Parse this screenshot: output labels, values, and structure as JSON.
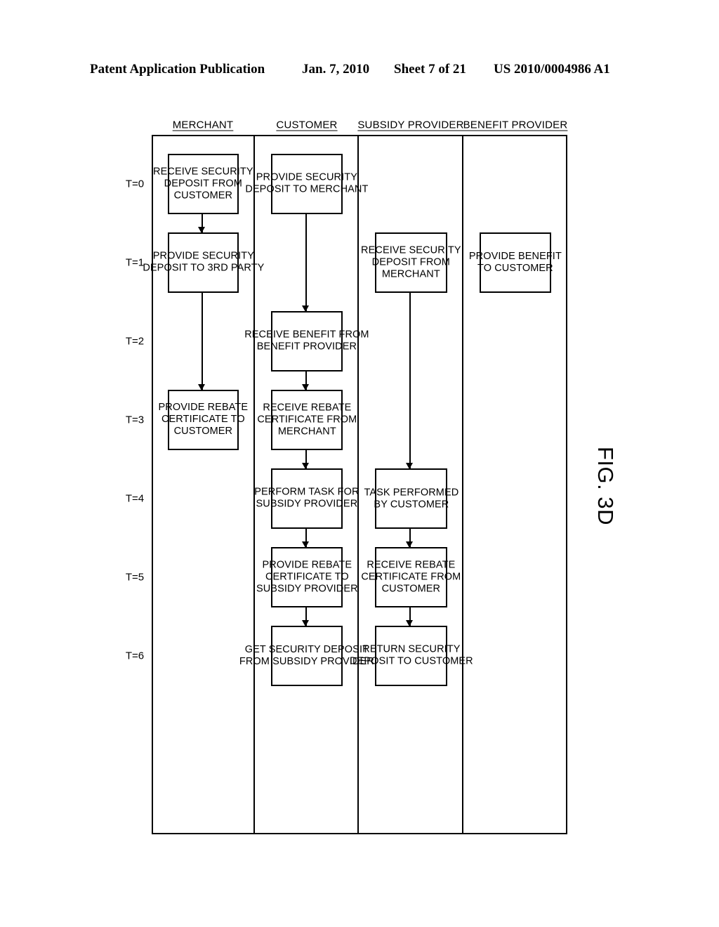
{
  "header": {
    "publication": "Patent Application Publication",
    "date": "Jan. 7, 2010",
    "sheet": "Sheet 7 of 21",
    "patent_number": "US 2010/0004986 A1"
  },
  "figure": {
    "caption": "FIG. 3D",
    "time_axis_label_prefix": "T=",
    "time_labels": [
      "T=0",
      "T=1",
      "T=2",
      "T=3",
      "T=4",
      "T=5",
      "T=6"
    ],
    "lanes": [
      {
        "id": "merchant",
        "title": "MERCHANT",
        "steps": [
          {
            "t": 0,
            "label": "RECEIVE SECURITY\nDEPOSIT FROM\nCUSTOMER"
          },
          {
            "t": 1,
            "label": "PROVIDE SECURITY\nDEPOSIT TO 3RD PARTY"
          },
          {
            "t": 3,
            "label": "PROVIDE REBATE\nCERTIFICATE TO\nCUSTOMER"
          }
        ],
        "arrows": [
          {
            "from_t": 0,
            "to_t": 1
          },
          {
            "from_t": 1,
            "to_t": 3
          }
        ]
      },
      {
        "id": "customer",
        "title": "CUSTOMER",
        "steps": [
          {
            "t": 0,
            "label": "PROVIDE SECURITY\nDEPOSIT TO MERCHANT"
          },
          {
            "t": 2,
            "label": "RECEIVE BENEFIT FROM\nBENEFIT PROVIDER"
          },
          {
            "t": 3,
            "label": "RECEIVE REBATE\nCERTIFICATE FROM\nMERCHANT"
          },
          {
            "t": 4,
            "label": "PERFORM TASK FOR\nSUBSIDY PROVIDER"
          },
          {
            "t": 5,
            "label": "PROVIDE REBATE\nCERTIFICATE TO\nSUBSIDY PROVIDER"
          },
          {
            "t": 6,
            "label": "GET SECURITY DEPOSIT\nFROM SUBSIDY PROVIDER"
          }
        ],
        "arrows": [
          {
            "from_t": 0,
            "to_t": 2
          },
          {
            "from_t": 2,
            "to_t": 3
          },
          {
            "from_t": 3,
            "to_t": 4
          },
          {
            "from_t": 4,
            "to_t": 5
          },
          {
            "from_t": 5,
            "to_t": 6
          }
        ]
      },
      {
        "id": "subsidy-provider",
        "title": "SUBSIDY PROVIDER",
        "steps": [
          {
            "t": 1,
            "label": "RECEIVE SECURITY\nDEPOSIT FROM\nMERCHANT"
          },
          {
            "t": 4,
            "label": "TASK PERFORMED\nBY CUSTOMER"
          },
          {
            "t": 5,
            "label": "RECEIVE REBATE\nCERTIFICATE FROM\nCUSTOMER"
          },
          {
            "t": 6,
            "label": "RETURN SECURITY\nDEPOSIT TO CUSTOMER"
          }
        ],
        "arrows": [
          {
            "from_t": 1,
            "to_t": 4
          },
          {
            "from_t": 4,
            "to_t": 5
          },
          {
            "from_t": 5,
            "to_t": 6
          }
        ]
      },
      {
        "id": "benefit-provider",
        "title": "BENEFIT PROVIDER",
        "steps": [
          {
            "t": 1,
            "label": "PROVIDE BENEFIT\nTO CUSTOMER"
          }
        ],
        "arrows": []
      }
    ]
  },
  "chart_data": {
    "type": "diagram",
    "diagram_type": "swimlane-flowchart",
    "orientation": "rotated-90-ccw",
    "title": "FIG. 3D",
    "axis": "time",
    "axis_ticks": [
      "T=0",
      "T=1",
      "T=2",
      "T=3",
      "T=4",
      "T=5",
      "T=6"
    ],
    "lane_order_top_to_bottom": [
      "BENEFIT PROVIDER",
      "SUBSIDY PROVIDER",
      "CUSTOMER",
      "MERCHANT"
    ],
    "nodes": [
      {
        "lane": "MERCHANT",
        "t": 0,
        "text": "RECEIVE SECURITY DEPOSIT FROM CUSTOMER"
      },
      {
        "lane": "MERCHANT",
        "t": 1,
        "text": "PROVIDE SECURITY DEPOSIT TO 3RD PARTY"
      },
      {
        "lane": "MERCHANT",
        "t": 3,
        "text": "PROVIDE REBATE CERTIFICATE TO CUSTOMER"
      },
      {
        "lane": "CUSTOMER",
        "t": 0,
        "text": "PROVIDE SECURITY DEPOSIT TO MERCHANT"
      },
      {
        "lane": "CUSTOMER",
        "t": 2,
        "text": "RECEIVE BENEFIT FROM BENEFIT PROVIDER"
      },
      {
        "lane": "CUSTOMER",
        "t": 3,
        "text": "RECEIVE REBATE CERTIFICATE FROM MERCHANT"
      },
      {
        "lane": "CUSTOMER",
        "t": 4,
        "text": "PERFORM TASK FOR SUBSIDY PROVIDER"
      },
      {
        "lane": "CUSTOMER",
        "t": 5,
        "text": "PROVIDE REBATE CERTIFICATE TO SUBSIDY PROVIDER"
      },
      {
        "lane": "CUSTOMER",
        "t": 6,
        "text": "GET SECURITY DEPOSIT FROM SUBSIDY PROVIDER"
      },
      {
        "lane": "SUBSIDY PROVIDER",
        "t": 1,
        "text": "RECEIVE SECURITY DEPOSIT FROM MERCHANT"
      },
      {
        "lane": "SUBSIDY PROVIDER",
        "t": 4,
        "text": "TASK PERFORMED BY CUSTOMER"
      },
      {
        "lane": "SUBSIDY PROVIDER",
        "t": 5,
        "text": "RECEIVE REBATE CERTIFICATE FROM CUSTOMER"
      },
      {
        "lane": "SUBSIDY PROVIDER",
        "t": 6,
        "text": "RETURN SECURITY DEPOSIT TO CUSTOMER"
      },
      {
        "lane": "BENEFIT PROVIDER",
        "t": 1,
        "text": "PROVIDE BENEFIT TO CUSTOMER"
      }
    ],
    "edges": [
      {
        "lane": "MERCHANT",
        "from_t": 0,
        "to_t": 1
      },
      {
        "lane": "MERCHANT",
        "from_t": 1,
        "to_t": 3
      },
      {
        "lane": "CUSTOMER",
        "from_t": 0,
        "to_t": 2
      },
      {
        "lane": "CUSTOMER",
        "from_t": 2,
        "to_t": 3
      },
      {
        "lane": "CUSTOMER",
        "from_t": 3,
        "to_t": 4
      },
      {
        "lane": "CUSTOMER",
        "from_t": 4,
        "to_t": 5
      },
      {
        "lane": "CUSTOMER",
        "from_t": 5,
        "to_t": 6
      },
      {
        "lane": "SUBSIDY PROVIDER",
        "from_t": 1,
        "to_t": 4
      },
      {
        "lane": "SUBSIDY PROVIDER",
        "from_t": 4,
        "to_t": 5
      },
      {
        "lane": "SUBSIDY PROVIDER",
        "from_t": 5,
        "to_t": 6
      }
    ],
    "colors": {
      "stroke": "#000000",
      "background": "#ffffff"
    }
  }
}
